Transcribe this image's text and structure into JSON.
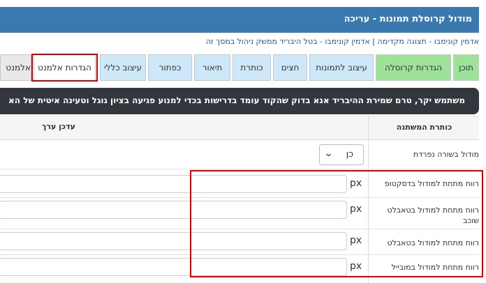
{
  "header": {
    "title": "מודול קרוסלת תמונות - עריכה"
  },
  "breadcrumb": {
    "items": [
      "אדמין קונימבו - תצוגה מקדימה",
      "אדמין קונימבו - בטל היבריד ממשק ניהול במסך זה"
    ],
    "separator": "|"
  },
  "tabs": [
    {
      "label": "תוכן"
    },
    {
      "label": "הגדרות קרוסלה"
    },
    {
      "label": "עיצוב לתמונות"
    },
    {
      "label": "חצים"
    },
    {
      "label": "כותרת"
    },
    {
      "label": "תיאור"
    },
    {
      "label": "כפתור"
    },
    {
      "label": "עיצוב כללי"
    },
    {
      "label": "הגדרות אלמנט"
    },
    {
      "label": "אלמנט"
    }
  ],
  "notice": {
    "text": "משתמש יקר, טרם שמירת ההיבריד אנא בדוק שהקוד עומד בדרישות בכדי למנוע פגיעה בציון גוגל וטעינה איטית של הא"
  },
  "table": {
    "headers": {
      "variable": "כותרת המשתנה",
      "value": "עדכן ערך"
    },
    "rows": [
      {
        "label": "מודול בשורה נפרדת",
        "select_value": "כן"
      },
      {
        "label": "רווח מתחת למודול בדסקטופ",
        "unit": "px",
        "value": ""
      },
      {
        "label": "רווח מתחת למודול בטאבלט שוכב",
        "unit": "px",
        "value": ""
      },
      {
        "label": "רווח מתחת למודול בטאבלט",
        "unit": "px",
        "value": ""
      },
      {
        "label": "רווח מתחת למודול במובייל",
        "unit": "px",
        "value": ""
      }
    ]
  },
  "colors": {
    "header_bg": "#3a78b0",
    "tab_green": "#9ee29a",
    "tab_blue": "#cfe8f9",
    "highlight": "#d60000",
    "notice_bg": "#33373d"
  }
}
